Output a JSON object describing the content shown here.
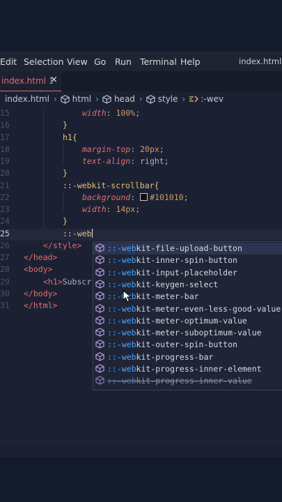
{
  "menu": {
    "items": [
      "Edit",
      "Selection",
      "View",
      "Go",
      "Run",
      "Terminal",
      "Help"
    ],
    "window_title": "index.html - a"
  },
  "tab": {
    "label": "index.html 1",
    "close": "×"
  },
  "breadcrumb": [
    "index.html",
    "html",
    "head",
    "style",
    ":-wev"
  ],
  "editor": {
    "lines": [
      {
        "n": "15",
        "kind": "prop",
        "indent": 84,
        "prop": "width",
        "val": "100%",
        "tail": ";"
      },
      {
        "n": "16",
        "kind": "close",
        "indent": 56
      },
      {
        "n": "17",
        "kind": "selector",
        "indent": 56,
        "text": "h1{"
      },
      {
        "n": "18",
        "kind": "prop",
        "indent": 84,
        "prop": "margin-top",
        "val": "20px",
        "tail": ";"
      },
      {
        "n": "19",
        "kind": "propword",
        "indent": 84,
        "prop": "text-align",
        "val": "right",
        "tail": ";"
      },
      {
        "n": "20",
        "kind": "close",
        "indent": 56
      },
      {
        "n": "21",
        "kind": "selector",
        "indent": 56,
        "text": "::-webkit-scrollbar{"
      },
      {
        "n": "22",
        "kind": "color",
        "indent": 84,
        "prop": "background",
        "val": "#101010",
        "tail": ";"
      },
      {
        "n": "23",
        "kind": "prop",
        "indent": 84,
        "prop": "width",
        "val": "14px",
        "tail": ";"
      },
      {
        "n": "24",
        "kind": "close",
        "indent": 56
      },
      {
        "n": "25",
        "kind": "typing",
        "indent": 56,
        "text": "::-web"
      },
      {
        "n": "26",
        "kind": "tag",
        "indent": 28,
        "text": "</style>"
      },
      {
        "n": "27",
        "kind": "tag",
        "indent": 0,
        "text": "</head>"
      },
      {
        "n": "28",
        "kind": "tag",
        "indent": 0,
        "text": "<body>"
      },
      {
        "n": "29",
        "kind": "tagtext",
        "indent": 28,
        "text": "<h1>",
        "after": "Subscr"
      },
      {
        "n": "30",
        "kind": "tag",
        "indent": 0,
        "text": "</body>"
      },
      {
        "n": "31",
        "kind": "tag",
        "indent": 0,
        "text": "</html>"
      }
    ]
  },
  "suggestions": [
    {
      "match": "::-web",
      "rest": "kit-file-upload-button",
      "active": true
    },
    {
      "match": "::-web",
      "rest": "kit-inner-spin-button"
    },
    {
      "match": "::-web",
      "rest": "kit-input-placeholder"
    },
    {
      "match": "::-web",
      "rest": "kit-keygen-select"
    },
    {
      "match": "::-web",
      "rest": "kit-meter-bar"
    },
    {
      "match": "::-web",
      "rest": "kit-meter-even-less-good-value"
    },
    {
      "match": "::-web",
      "rest": "kit-meter-optimum-value"
    },
    {
      "match": "::-web",
      "rest": "kit-meter-suboptimum-value"
    },
    {
      "match": "::-web",
      "rest": "kit-outer-spin-button"
    },
    {
      "match": "::-web",
      "rest": "kit-progress-bar"
    },
    {
      "match": "::-web",
      "rest": "kit-progress-inner-element"
    },
    {
      "match": "::-web",
      "rest": "kit-progress-inner-value",
      "faded": true
    }
  ],
  "colors": {
    "accent_error": "#e06c75",
    "match_highlight": "#4aa3ff",
    "editor_bg": "#1b2132"
  }
}
